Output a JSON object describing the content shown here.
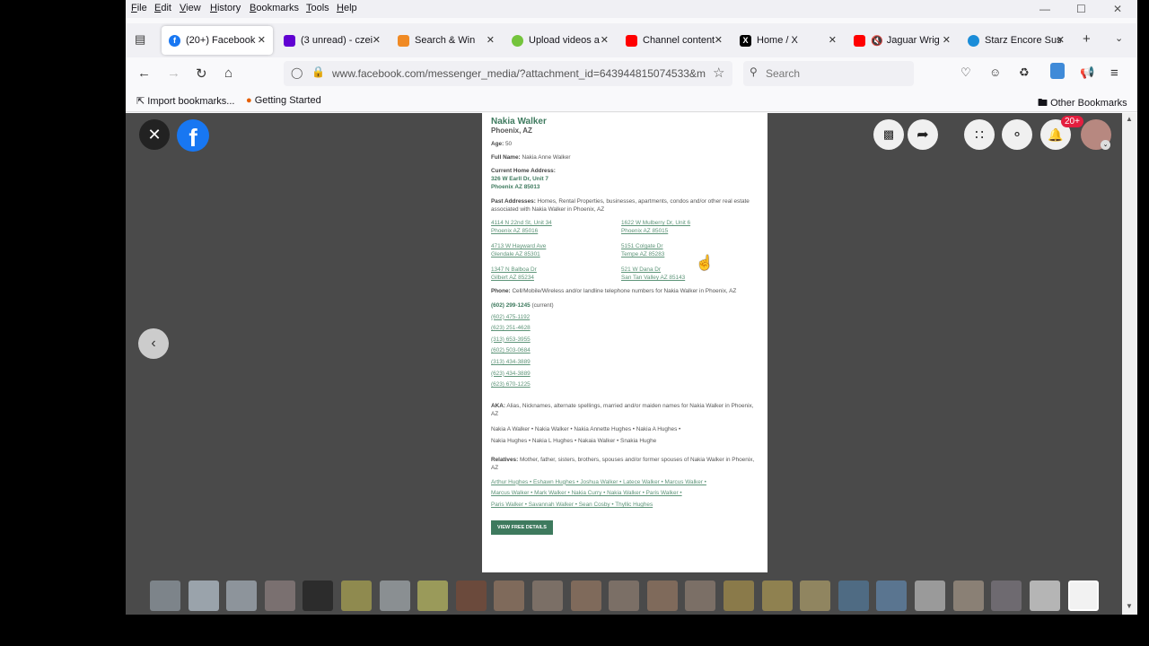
{
  "menu": [
    "File",
    "Edit",
    "View",
    "History",
    "Bookmarks",
    "Tools",
    "Help"
  ],
  "tabs": [
    {
      "label": "(20+) Facebook",
      "favicon_color": "#1877f2",
      "active": true
    },
    {
      "label": "(3 unread) - czei",
      "favicon_color": "#6001d2",
      "active": false
    },
    {
      "label": "Search & Win",
      "favicon_color": "#f08a24",
      "active": false
    },
    {
      "label": "Upload videos a",
      "favicon_color": "#74c43c",
      "active": false
    },
    {
      "label": "Channel content",
      "favicon_color": "#ff0000",
      "active": false
    },
    {
      "label": "Home / X",
      "favicon_color": "#000000",
      "active": false
    },
    {
      "label": "Jaguar Wrig",
      "favicon_color": "#ff0000",
      "active": false
    },
    {
      "label": "Starz Encore Sus",
      "favicon_color": "#1a8cd8",
      "active": false
    }
  ],
  "nav": {
    "url": "www.facebook.com/messenger_media/?attachment_id=643944815074533&m",
    "search_placeholder": "Search"
  },
  "bookmarks": {
    "import": "Import bookmarks...",
    "getting_started": "Getting Started",
    "other": "Other Bookmarks"
  },
  "viewer": {
    "notification_badge": "20+"
  },
  "document": {
    "name": "Nakia Walker",
    "city": "Phoenix, AZ",
    "age_label": "Age:",
    "age": "50",
    "fullname_label": "Full Name:",
    "fullname": "Nakia Anne Walker",
    "home_label": "Current Home Address:",
    "home_line1": "326 W Earll Dr, Unit 7",
    "home_line2": "Phoenix AZ 85013",
    "past_label": "Past Addresses:",
    "past_desc": "Homes, Rental Properties, businesses, apartments, condos and/or other real estate associated with Nakia Walker in Phoenix, AZ",
    "past_addresses": [
      {
        "l1": "4114 N 22nd St, Unit 34",
        "l2": "Phoenix AZ 85016"
      },
      {
        "l1": "1622 W Mulberry Dr, Unit 6",
        "l2": "Phoenix AZ 85015"
      },
      {
        "l1": "4713 W Hayward Ave",
        "l2": "Glendale AZ 85301"
      },
      {
        "l1": "5151 Colgate Dr",
        "l2": "Tempe AZ 85283"
      },
      {
        "l1": "1347 N Balboa Dr",
        "l2": "Gilbert AZ 85234"
      },
      {
        "l1": "521 W Dana Dr",
        "l2": "San Tan Valley AZ 85143"
      }
    ],
    "phone_label": "Phone:",
    "phone_desc": "Cell/Mobile/Wireless and/or landline telephone numbers for Nakia Walker in Phoenix, AZ",
    "phone_current": "(602) 299-1245",
    "phone_current_note": "(current)",
    "phones": [
      "(602) 475-1192",
      "(623) 251-4628",
      "(313) 653-3955",
      "(602) 503-0684",
      "(313) 434-3889",
      "(623) 434-3889",
      "(623) 670-1225"
    ],
    "aka_label": "AKA:",
    "aka_desc": "Alias, Nicknames, alternate spellings, married and/or maiden names for Nakia Walker in Phoenix, AZ",
    "aka_line1": "Nakia A Walker • Nakia Walker • Nakia Annette Hughes • Nakia A Hughes •",
    "aka_line2": "Nakia Hughes • Nakia L Hughes • Nakaia Walker • Snakia Hughe",
    "relatives_label": "Relatives:",
    "relatives_desc": "Mother, father, sisters, brothers, spouses and/or former spouses of Nakia Walker in Phoenix, AZ",
    "relatives_line1": "Arthur Hughes • Eshawn Hughes • Joshua Walker • Latece Walker • Marcus Walker •",
    "relatives_line2": "Marcus Walker • Mark Walker • Nakia Curry • Nakia Walker • Paris Walker •",
    "relatives_line3": "Paris Walker • Savannah Walker • Sean Cosby • Thyllic Hughes",
    "button": "VIEW FREE DETAILS"
  }
}
